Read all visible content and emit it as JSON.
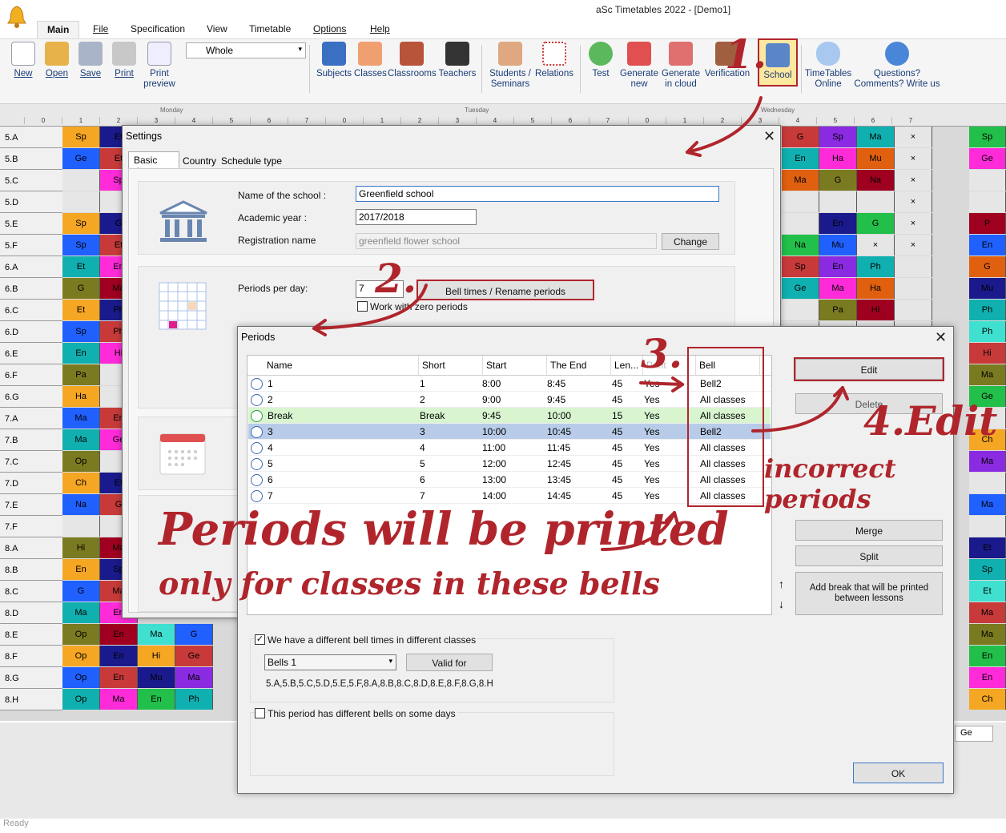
{
  "app": {
    "title": "aSc Timetables 2022  - [Demo1]",
    "status": "Ready"
  },
  "menu": {
    "tabs": [
      "Main",
      "File",
      "Specification",
      "View",
      "Timetable",
      "Options",
      "Help"
    ]
  },
  "ribbon": {
    "new": "New",
    "open": "Open",
    "save": "Save",
    "print": "Print",
    "print_preview_1": "Print",
    "print_preview_2": "preview",
    "view_select": "Whole",
    "subjects": "Subjects",
    "classes": "Classes",
    "classrooms": "Classrooms",
    "teachers": "Teachers",
    "students_1": "Students /",
    "students_2": "Seminars",
    "relations": "Relations",
    "test": "Test",
    "generate_new_1": "Generate",
    "generate_new_2": "new",
    "generate_cloud_1": "Generate",
    "generate_cloud_2": "in cloud",
    "verification": "Verification",
    "school": "School",
    "online_1": "TimeTables",
    "online_2": "Online",
    "questions_1": "Questions?",
    "questions_2": "Comments? Write us"
  },
  "grid": {
    "days": [
      "Monday",
      "Tuesday",
      "Wednesday"
    ],
    "period_numbers": [
      "0",
      "1",
      "2",
      "3",
      "4",
      "5",
      "6",
      "7"
    ],
    "classes": [
      "5.A",
      "5.B",
      "5.C",
      "5.D",
      "5.E",
      "5.F",
      "6.A",
      "6.B",
      "6.C",
      "6.D",
      "6.E",
      "6.F",
      "6.G",
      "7.A",
      "7.B",
      "7.C",
      "7.D",
      "7.E",
      "7.F",
      "8.A",
      "8.B",
      "8.C",
      "8.D",
      "8.E",
      "8.F",
      "8.G",
      "8.H"
    ],
    "left_cells": [
      [
        "Sp",
        "Et"
      ],
      [
        "Ge",
        "Et"
      ],
      [
        "",
        "Sp"
      ],
      [
        "",
        ""
      ],
      [
        "Sp",
        "G"
      ],
      [
        "Sp",
        "Et"
      ],
      [
        "Et",
        "En"
      ],
      [
        "G",
        "Ma"
      ],
      [
        "Et",
        "Ph"
      ],
      [
        "Sp",
        "Ph"
      ],
      [
        "En",
        "Hi"
      ],
      [
        "Pa",
        ""
      ],
      [
        "Ha",
        ""
      ],
      [
        "Ma",
        "En"
      ],
      [
        "Ma",
        "Ge"
      ],
      [
        "Op",
        ""
      ],
      [
        "Ch",
        "Et"
      ],
      [
        "Na",
        "G"
      ],
      [
        "",
        ""
      ],
      [
        "Hi",
        "Ma"
      ],
      [
        "En",
        "Sp"
      ],
      [
        "G",
        "Ma"
      ],
      [
        "Ma",
        "En"
      ],
      [
        "Op",
        "En"
      ],
      [
        "Op",
        "En"
      ],
      [
        "Op",
        "En"
      ],
      [
        "Op",
        "Ma"
      ]
    ],
    "bottom_cells": [
      [
        "Ma",
        "G"
      ],
      [
        "Hi",
        "Ge"
      ],
      [
        "Mu",
        "Ma"
      ],
      [
        "En",
        "Ph"
      ]
    ],
    "right_cells": [
      [
        "G",
        "Sp",
        "Ma",
        "×"
      ],
      [
        "En",
        "Ha",
        "Mu",
        "×"
      ],
      [
        "Ma",
        "G",
        "Na",
        "×"
      ],
      [
        "",
        "",
        "",
        "×"
      ],
      [
        "",
        "En",
        "G",
        "×"
      ],
      [
        "Na",
        "Mu",
        "×",
        "×"
      ],
      [
        "Sp",
        "En",
        "Ph",
        ""
      ],
      [
        "Ge",
        "Ma",
        "Ha",
        ""
      ],
      [
        "",
        "Pa",
        "Hi",
        ""
      ],
      [
        "",
        "",
        "",
        ""
      ]
    ],
    "far_right_cells": [
      "Sp",
      "Ge",
      "",
      "",
      "P",
      "En",
      "G",
      "Mu",
      "Ph",
      "Ph",
      "Hi",
      "Ma",
      "Ge",
      "",
      "Ch",
      "Ma",
      "",
      "Ma",
      "",
      "Et",
      "Sp",
      "Et",
      "Ma",
      "Ma",
      "En",
      "En",
      "Ch"
    ],
    "bottom_label": "Ge"
  },
  "settings": {
    "title": "Settings",
    "tabs": [
      "Basic data",
      "Country",
      "Schedule type"
    ],
    "school_name_label": "Name of the school :",
    "school_name": "Greenfield school",
    "academic_year_label": "Academic year :",
    "academic_year": "2017/2018",
    "registration_label": "Registration name",
    "registration": "greenfield flower school",
    "change": "Change",
    "periods_per_day_label": "Periods per day:",
    "periods_per_day": "7",
    "bell_times": "Bell times / Rename periods",
    "zero_periods": "Work with zero periods"
  },
  "periods": {
    "title": "Periods",
    "columns": [
      "Name",
      "Short",
      "Start",
      "The End",
      "Len...",
      "Print",
      "Bell"
    ],
    "rows": [
      {
        "name": "1",
        "short": "1",
        "start": "8:00",
        "end": "8:45",
        "len": "45",
        "print": "Yes",
        "bell": "Bell2",
        "type": "clock"
      },
      {
        "name": "2",
        "short": "2",
        "start": "9:00",
        "end": "9:45",
        "len": "45",
        "print": "Yes",
        "bell": "All classes",
        "type": "clock"
      },
      {
        "name": "Break",
        "short": "Break",
        "start": "9:45",
        "end": "10:00",
        "len": "15",
        "print": "Yes",
        "bell": "All classes",
        "type": "break"
      },
      {
        "name": "3",
        "short": "3",
        "start": "10:00",
        "end": "10:45",
        "len": "45",
        "print": "Yes",
        "bell": "Bell2",
        "type": "selected"
      },
      {
        "name": "4",
        "short": "4",
        "start": "11:00",
        "end": "11:45",
        "len": "45",
        "print": "Yes",
        "bell": "All classes",
        "type": "clock"
      },
      {
        "name": "5",
        "short": "5",
        "start": "12:00",
        "end": "12:45",
        "len": "45",
        "print": "Yes",
        "bell": "All classes",
        "type": "clock"
      },
      {
        "name": "6",
        "short": "6",
        "start": "13:00",
        "end": "13:45",
        "len": "45",
        "print": "Yes",
        "bell": "All classes",
        "type": "clock"
      },
      {
        "name": "7",
        "short": "7",
        "start": "14:00",
        "end": "14:45",
        "len": "45",
        "print": "Yes",
        "bell": "All classes",
        "type": "clock"
      }
    ],
    "edit": "Edit",
    "delete": "Delete",
    "merge": "Merge",
    "split": "Split",
    "add_break_1": "Add break that will be printed",
    "add_break_2": "between lessons",
    "different_bells": "We have a different bell times in different classes",
    "bells_select": "Bells 1",
    "valid_for": "Valid for",
    "bells_classes": "5.A,5.B,5.C,5.D,5.E,5.F,8.A,8.B,8.C,8.D,8.E,8.F,8.G,8.H",
    "different_days": "This period has different bells on some days",
    "ok": "OK"
  },
  "annotations": {
    "step1": "1.",
    "step2": "2.",
    "step3": "3.",
    "step4": "4.Edit",
    "step4_sub": "incorrect periods",
    "note_1": "Periods will be printed",
    "note_2": "only for classes in these bells"
  },
  "colors": {
    "annotation": "#b0252c",
    "selected_row": "#b8cbe8",
    "break_row": "#d8f5d0",
    "link": "#1a3c78"
  }
}
